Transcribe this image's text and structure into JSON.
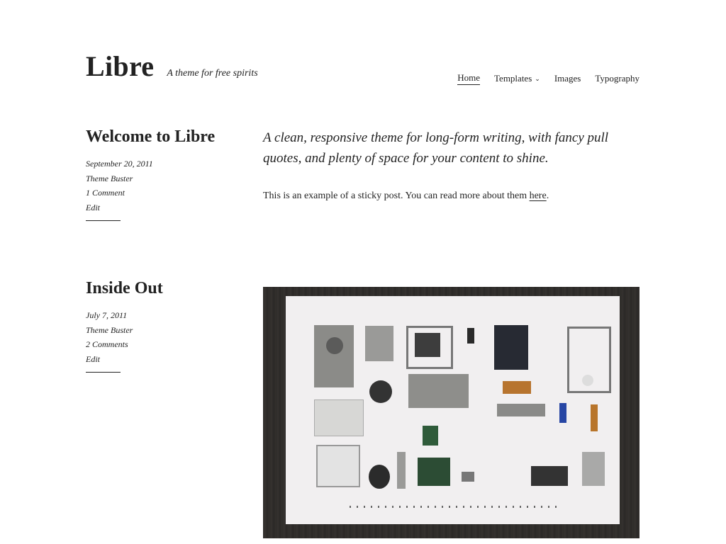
{
  "site": {
    "title": "Libre",
    "tagline": "A theme for free spirits"
  },
  "nav": {
    "items": [
      {
        "label": "Home",
        "current": true
      },
      {
        "label": "Templates",
        "has_submenu": true
      },
      {
        "label": "Images"
      },
      {
        "label": "Typography"
      }
    ]
  },
  "posts": [
    {
      "title": "Welcome to Libre",
      "date": "September 20, 2011",
      "author": "Theme Buster",
      "comments": "1 Comment",
      "edit": "Edit",
      "pullquote": "A clean, responsive theme for long-form writing, with fancy pull quotes, and plenty of space for your content to shine.",
      "text_before_link": "This is an example of a sticky post. You can read more about them ",
      "link_text": "here",
      "text_after_link": "."
    },
    {
      "title": "Inside Out",
      "date": "July 7, 2011",
      "author": "Theme Buster",
      "comments": "2 Comments",
      "edit": "Edit"
    }
  ],
  "colors": {
    "text": "#222222",
    "background": "#ffffff"
  }
}
